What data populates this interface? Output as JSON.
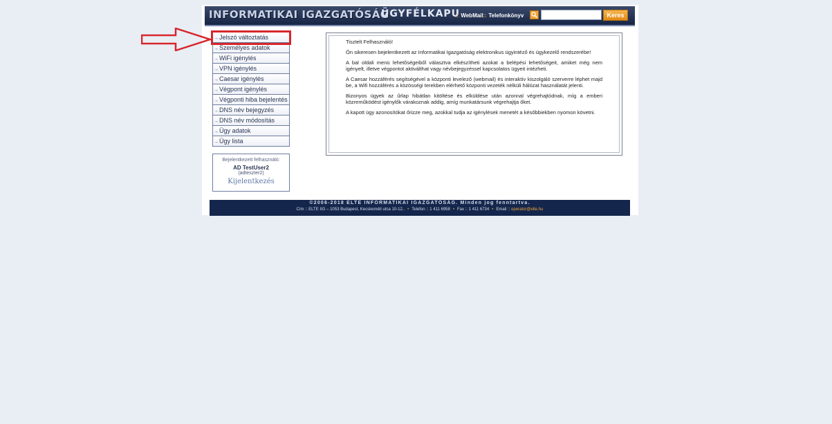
{
  "header": {
    "brand": "INFORMATIKAI IGAZGATÓSÁG",
    "section": "ÜGYFÉLKAPU",
    "links": [
      {
        "label": "WebMail"
      },
      {
        "label": "Telefonkönyv"
      }
    ],
    "search_placeholder": "",
    "search_button": "Keres",
    "colors": {
      "bar": "#1f2f52",
      "accent": "#f0a53a"
    }
  },
  "sidebar": {
    "items": [
      {
        "label": "Jelszó változtatás",
        "highlighted": true
      },
      {
        "label": "Személyes adatok"
      },
      {
        "label": "WiFi igénylés"
      },
      {
        "label": "VPN igénylés"
      },
      {
        "label": "Caesar igénylés"
      },
      {
        "label": "Végpont igénylés"
      },
      {
        "label": "Végponti hiba bejelentés"
      },
      {
        "label": "DNS név bejegyzés"
      },
      {
        "label": "DNS név módosítás"
      },
      {
        "label": "Ügy adatok"
      },
      {
        "label": "Ügy lista"
      }
    ]
  },
  "user": {
    "label": "Bejelentkezett felhasználó:",
    "name": "AD TestUser2",
    "id": "(adteszter2)",
    "logout": "Kijelentkezés"
  },
  "content": {
    "paragraphs": [
      "Tisztelt Felhasználó!",
      "Ön sikeresen bejelentkezett az Informatikai Igazgatóság elektronikus ügyintéző és ügykezelő rendszerébe!",
      "A bal oldali menü lehetőségeiből választva elkészítheti azokat a belépési lehetőségeit, amiket még nem igényelt, illetve végpontot aktiválthat vagy névbejegyzéssel kapcsolatos ügyeit intézheti.",
      "A Caesar hozzáférés segítségével a központi levelező (webmail) és interaktív kiszolgáló szerverre léphet majd be, a Wifi hozzáférés a közösségi terekben elérhető központi vezeték nélküli hálózat használatát jelenti.",
      "Bizonyos ügyek az űrlap hibátlan kitöltése és elküldése után azonnal végrehajtódnak, míg a emberi közreműködést igénylők várakoznak addig, amíg munkatársunk végrehajtja őket.",
      "A kapott ügy azonosítókat őrizze meg, azokkal tudja az igénylések menetét a későbbiekben nyomon követni."
    ]
  },
  "footer": {
    "copyright": "©2006-2018 ELTE INFORMATIKAI IGAZGATÓSÁG. Minden jog fenntartva.",
    "address": "Cím :: ELTE IIG – 1053 Budapest, Kecskeméti utca 10-12..",
    "phone": "Telefon :: 1 411 6958",
    "fax": "Fax :: 1 411 6734",
    "email_label": "Email ::",
    "email": "operator@elte.hu"
  },
  "annotation": {
    "color": "#d8262c"
  }
}
